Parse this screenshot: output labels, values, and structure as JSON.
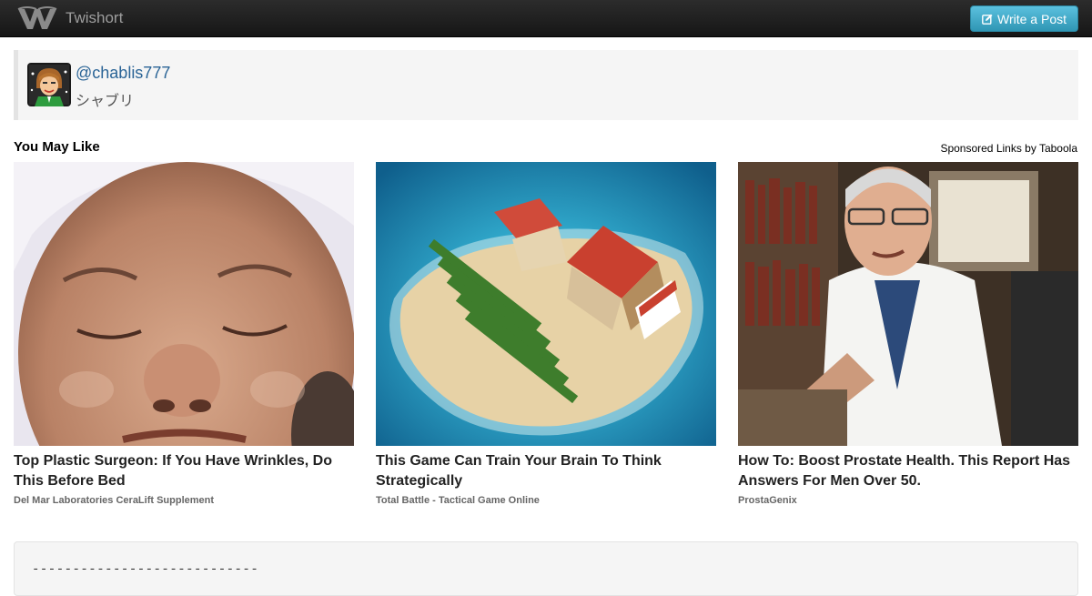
{
  "app": {
    "name": "Twishort",
    "logo_icon": "twishort-logo-icon"
  },
  "header": {
    "write_button_label": "Write a Post",
    "write_button_icon": "edit-icon",
    "button_color": "#49afcd"
  },
  "profile": {
    "handle_prefix": "@",
    "handle": "chablis777",
    "display_name": "シャブリ"
  },
  "recommendations": {
    "title": "You May Like",
    "sponsored_label": "Sponsored Links by Taboola",
    "items": [
      {
        "title": "Top Plastic Surgeon: If You Have Wrinkles, Do This Before Bed",
        "source": "Del Mar Laboratories CeraLift Supplement"
      },
      {
        "title": "This Game Can Train Your Brain To Think Strategically",
        "source": "Total Battle - Tactical Game Online"
      },
      {
        "title": "How To: Boost Prostate Health. This Report Has Answers For Men Over 50.",
        "source": "ProstaGenix"
      }
    ]
  },
  "post": {
    "text": "----------------------------"
  }
}
